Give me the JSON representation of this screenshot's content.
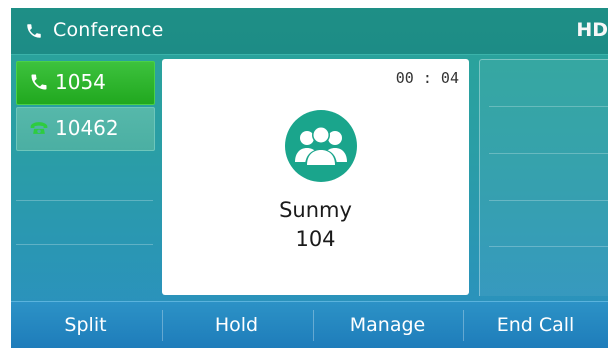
{
  "titlebar": {
    "title": "Conference",
    "hd_label": "HD"
  },
  "lines": [
    {
      "label": "1054",
      "state": "active"
    },
    {
      "label": "10462",
      "state": "held"
    }
  ],
  "call": {
    "timer": "00 : 04",
    "name": "Sunmy",
    "number": "104"
  },
  "softkeys": [
    "Split",
    "Hold",
    "Manage",
    "End Call"
  ],
  "colors": {
    "active_line": "#21a81f",
    "held_line": "#4bafa3",
    "conference_icon": "#1aa58c",
    "softkey_bar": "#1e7cba"
  }
}
